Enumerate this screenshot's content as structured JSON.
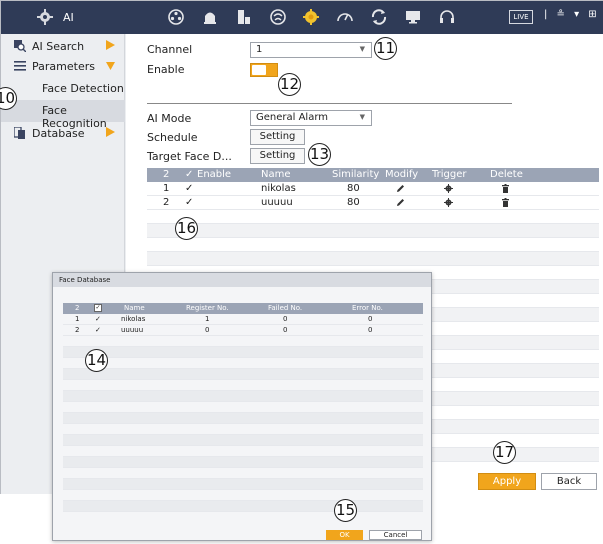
{
  "topbar": {
    "title": "AI",
    "icons": [
      "ai-icon",
      "camera-icon",
      "playback-icon",
      "storage-icon",
      "network-icon",
      "ai-active-icon",
      "performance-icon",
      "maintenance-icon",
      "display-icon",
      "audio-icon"
    ],
    "live_label": "LIVE",
    "right_text": "|  ≗ ▾ ⊞"
  },
  "sidebar": {
    "items": [
      {
        "label": "AI Search",
        "icon": "search-icon"
      },
      {
        "label": "Parameters",
        "icon": "list-icon"
      },
      {
        "label": "Database",
        "icon": "database-icon"
      }
    ],
    "subitems": [
      {
        "label": "Face Detection"
      },
      {
        "label": "Face Recognition"
      }
    ]
  },
  "form": {
    "channel_label": "Channel",
    "channel_value": "1",
    "enable_label": "Enable",
    "ai_mode_label": "AI Mode",
    "ai_mode_value": "General Alarm",
    "schedule_label": "Schedule",
    "schedule_button": "Setting",
    "target_face_label": "Target Face D...",
    "target_face_button": "Setting"
  },
  "face_table": {
    "header": {
      "count": "2",
      "enable": "Enable",
      "name": "Name",
      "similarity": "Similarity",
      "modify": "Modify",
      "trigger": "Trigger",
      "delete": "Delete"
    },
    "rows": [
      {
        "index": "1",
        "name": "nikolas",
        "similarity": "80"
      },
      {
        "index": "2",
        "name": "uuuuu",
        "similarity": "80"
      }
    ]
  },
  "buttons": {
    "apply": "Apply",
    "back": "Back"
  },
  "dialog": {
    "title": "Face Database",
    "header": {
      "count": "2",
      "name": "Name",
      "register_no": "Register No.",
      "failed_no": "Failed No.",
      "error_no": "Error No."
    },
    "rows": [
      {
        "index": "1",
        "name": "nikolas",
        "register_no": "1",
        "failed_no": "0",
        "error_no": "0"
      },
      {
        "index": "2",
        "name": "uuuuu",
        "register_no": "0",
        "failed_no": "0",
        "error_no": "0"
      }
    ],
    "ok": "OK",
    "cancel": "Cancel"
  },
  "callouts": {
    "c10": "10",
    "c11": "11",
    "c12": "12",
    "c13": "13",
    "c14": "14",
    "c15": "15",
    "c16": "16",
    "c17": "17"
  },
  "colors": {
    "topbar": "#2f3b57",
    "accent": "#f1a51c",
    "table_header": "#9ba4b5"
  }
}
